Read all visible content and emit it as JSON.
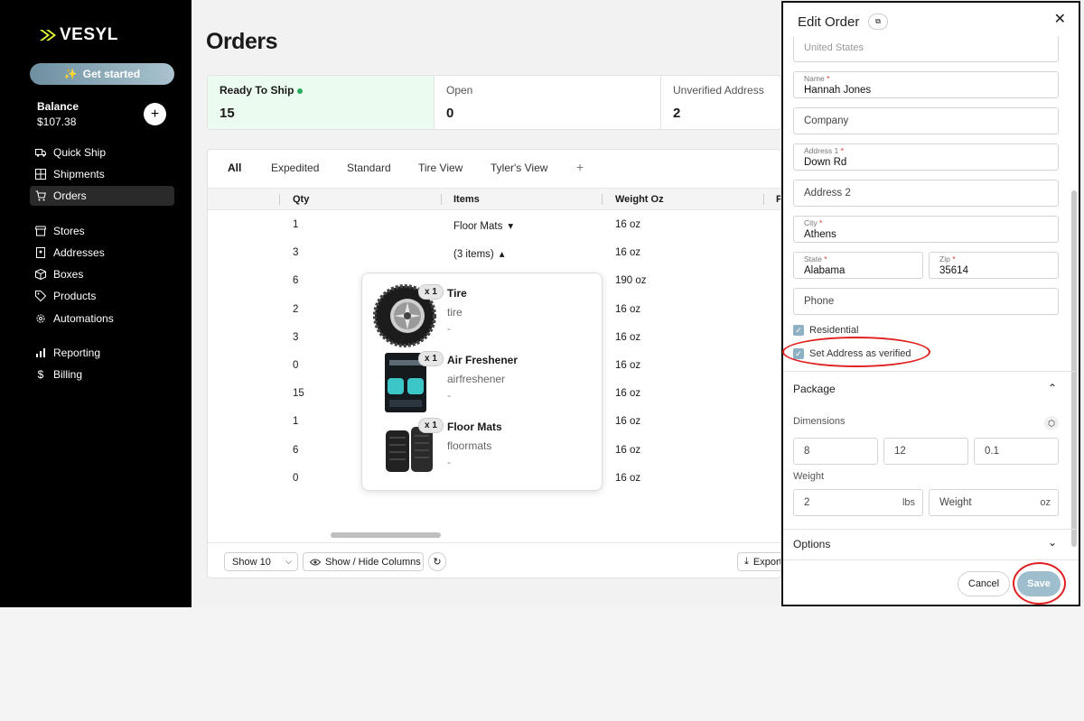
{
  "sidebar": {
    "logo": "VESYL",
    "get_started": "Get started",
    "balance_label": "Balance",
    "balance_value": "$107.38",
    "add_symbol": "+",
    "nav": [
      {
        "label": "Quick Ship",
        "icon": "truck-icon"
      },
      {
        "label": "Shipments",
        "icon": "grid-icon"
      },
      {
        "label": "Orders",
        "icon": "cart-icon",
        "active": true
      },
      {
        "label": "Stores",
        "icon": "store-icon"
      },
      {
        "label": "Addresses",
        "icon": "address-book-icon"
      },
      {
        "label": "Boxes",
        "icon": "box-icon"
      },
      {
        "label": "Products",
        "icon": "tag-icon"
      },
      {
        "label": "Automations",
        "icon": "gear-icon"
      },
      {
        "label": "Reporting",
        "icon": "bar-chart-icon"
      },
      {
        "label": "Billing",
        "icon": "dollar-icon"
      }
    ]
  },
  "main": {
    "title": "Orders",
    "stats": [
      {
        "label": "Ready To Ship",
        "value": "15"
      },
      {
        "label": "Open",
        "value": "0"
      },
      {
        "label": "Unverified Address",
        "value": "2"
      }
    ],
    "tabs": [
      "All",
      "Expedited",
      "Standard",
      "Tire View",
      "Tyler's View",
      "+"
    ],
    "columns": [
      "Qty",
      "Items",
      "Weight Oz",
      "P"
    ],
    "rows": [
      {
        "qty": "1",
        "items": "Floor Mats",
        "caret": "▾",
        "weight": "16 oz"
      },
      {
        "qty": "3",
        "items": "(3 items)",
        "caret": "▴",
        "weight": "16 oz"
      },
      {
        "qty": "6",
        "items": "",
        "caret": "",
        "weight": "190 oz"
      },
      {
        "qty": "2",
        "items": "",
        "caret": "",
        "weight": "16 oz"
      },
      {
        "qty": "3",
        "items": "",
        "caret": "",
        "weight": "16 oz"
      },
      {
        "qty": "0",
        "items": "",
        "caret": "",
        "weight": "16 oz"
      },
      {
        "qty": "15",
        "items": "",
        "caret": "",
        "weight": "16 oz"
      },
      {
        "qty": "1",
        "items": "",
        "caret": "",
        "weight": "16 oz"
      },
      {
        "qty": "6",
        "items": "",
        "caret": "",
        "weight": "16 oz"
      },
      {
        "qty": "0",
        "items": "",
        "caret": "",
        "weight": "16 oz"
      }
    ],
    "footer": {
      "show": "Show 10",
      "columns_btn": "Show / Hide Columns",
      "export": "Export"
    }
  },
  "popover": {
    "items": [
      {
        "qty": "x 1",
        "name": "Tire",
        "sku": "tire",
        "extra": "-"
      },
      {
        "qty": "x 1",
        "name": "Air Freshener",
        "sku": "airfreshener",
        "extra": "-"
      },
      {
        "qty": "x 1",
        "name": "Floor Mats",
        "sku": "floormats",
        "extra": "-"
      }
    ]
  },
  "panel": {
    "title": "Edit Order",
    "badge": "⧉",
    "close": "✕",
    "country": "United States",
    "name_label": "Name",
    "name": "Hannah Jones",
    "company_ph": "Company",
    "address1_label": "Address 1",
    "address1": "Down Rd",
    "address2_ph": "Address 2",
    "city_label": "City",
    "city": "Athens",
    "state_label": "State",
    "state": "Alabama",
    "zip_label": "Zip",
    "zip": "35614",
    "phone_ph": "Phone",
    "residential": "Residential",
    "verified": "Set Address as verified",
    "package_title": "Package",
    "dimensions_label": "Dimensions",
    "dims": [
      "8",
      "12",
      "0.1"
    ],
    "weight_label": "Weight",
    "weight_lbs": "2",
    "lbs_unit": "lbs",
    "weight_oz_ph": "Weight",
    "oz_unit": "oz",
    "options_title": "Options",
    "cancel": "Cancel",
    "save": "Save",
    "required_mark": "*"
  },
  "colors": {
    "ready_bg": "#ecfbf0",
    "status_dot": "#27ae60",
    "save_bg": "#9fbecd",
    "annotation": "#e02020"
  }
}
